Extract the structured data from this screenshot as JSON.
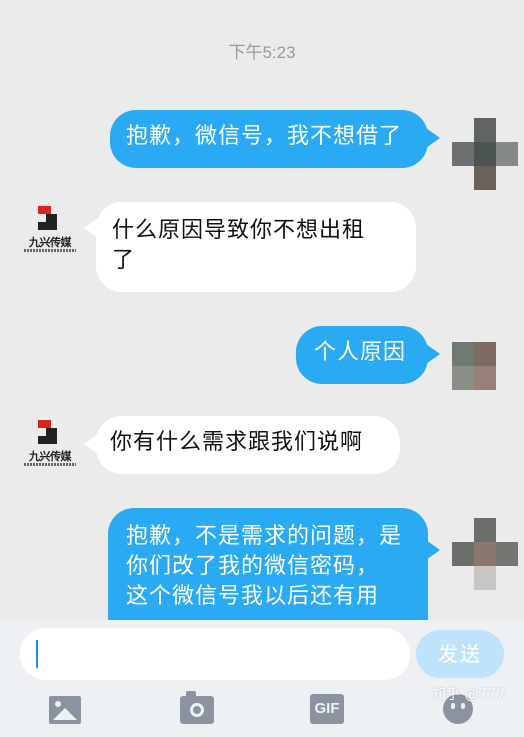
{
  "timestamp": "下午5:23",
  "messages": [
    {
      "id": "m1",
      "from": "me",
      "text": "抱歉，微信号，我不想借了"
    },
    {
      "id": "m2",
      "from": "them",
      "lines": [
        "什么原因导致你不想出租",
        "了"
      ]
    },
    {
      "id": "m3",
      "from": "me",
      "text": "个人原因"
    },
    {
      "id": "m4",
      "from": "them",
      "text": "你有什么需求跟我们说啊"
    },
    {
      "id": "m5",
      "from": "me",
      "lines": [
        "抱歉，不是需求的问题，是",
        "你们改了我的微信密码，",
        "这个微信号我以后还有用"
      ]
    }
  ],
  "company_avatar": {
    "name": "九兴传媒"
  },
  "input": {
    "value": "",
    "placeholder": ""
  },
  "send_label": "发送",
  "toolbar": {
    "image_icon": "image-icon",
    "camera_icon": "camera-icon",
    "gif_label": "GIF",
    "emoji_icon": "emoji-icon"
  },
  "watermark": "知乎 @777",
  "colors": {
    "outgoing_bubble": "#29aaf2",
    "incoming_bubble": "#ffffff",
    "background": "#ebebeb",
    "send_button": "#bfe3fb"
  }
}
